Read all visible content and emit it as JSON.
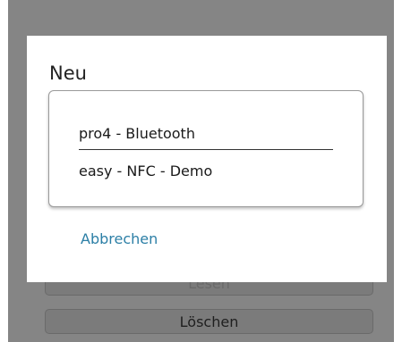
{
  "background": {
    "hidden_button_label": "Lesen",
    "delete_button_label": "Löschen"
  },
  "dialog": {
    "title": "Neu",
    "items": [
      {
        "label": "pro4 - Bluetooth"
      },
      {
        "label": "easy - NFC - Demo"
      }
    ],
    "cancel_label": "Abbrechen"
  },
  "colors": {
    "overlay": "#858585",
    "accent": "#2c7fa6"
  }
}
